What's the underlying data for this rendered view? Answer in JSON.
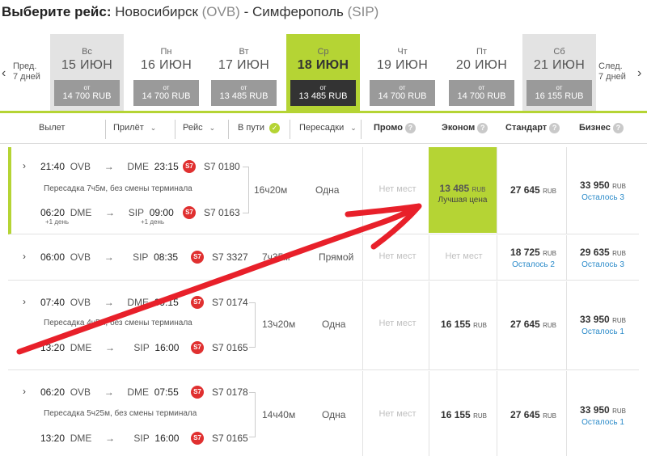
{
  "title": {
    "prefix": "Выберите рейс:",
    "from": "Новосибирск",
    "from_code": "(OVB)",
    "dash": "-",
    "to": "Симферополь",
    "to_code": "(SIP)"
  },
  "nav": {
    "prev": "Пред.",
    "prev_days": "7 дней",
    "next": "След.",
    "next_days": "7 дней"
  },
  "days": [
    {
      "dow": "Вс",
      "date": "15 ИЮН",
      "from": "от",
      "price": "14 700 RUB"
    },
    {
      "dow": "Пн",
      "date": "16 ИЮН",
      "from": "от",
      "price": "14 700 RUB"
    },
    {
      "dow": "Вт",
      "date": "17 ИЮН",
      "from": "от",
      "price": "13 485 RUB"
    },
    {
      "dow": "Ср",
      "date": "18 ИЮН",
      "from": "от",
      "price": "13 485 RUB"
    },
    {
      "dow": "Чт",
      "date": "19 ИЮН",
      "from": "от",
      "price": "14 700 RUB"
    },
    {
      "dow": "Пт",
      "date": "20 ИЮН",
      "from": "от",
      "price": "14 700 RUB"
    },
    {
      "dow": "Сб",
      "date": "21 ИЮН",
      "from": "от",
      "price": "16 155 RUB"
    }
  ],
  "header": {
    "departure": "Вылет",
    "arrival": "Прилёт",
    "flight": "Рейс",
    "duration": "В пути",
    "transfers": "Пересадки",
    "promo": "Промо",
    "economy": "Эконом",
    "standard": "Стандарт",
    "business": "Бизнес",
    "q": "?",
    "dropdown": "⌄",
    "check": "✓"
  },
  "currency": "RUB",
  "flights": [
    {
      "seg1": {
        "dep_time": "21:40",
        "dep_ap": "OVB",
        "arr_ap": "DME",
        "arr_time": "23:15",
        "flight_no": "S7 0180"
      },
      "transfer_note": "Пересадка 7ч5м, без смены терминала",
      "seg2": {
        "dep_time": "06:20",
        "dep_ap": "DME",
        "arr_ap": "SIP",
        "arr_time": "09:00",
        "flight_no": "S7 0163",
        "dep_plus": "+1 день",
        "arr_plus": "+1 день"
      },
      "duration": "16ч20м",
      "stops": "Одна",
      "promo": "Нет мест",
      "economy": "13 485",
      "economy_label": "Лучшая цена",
      "standard": "27 645",
      "business": "33 950",
      "business_sub": "Осталось 3"
    },
    {
      "seg1": {
        "dep_time": "06:00",
        "dep_ap": "OVB",
        "arr_ap": "SIP",
        "arr_time": "08:35",
        "flight_no": "S7 3327"
      },
      "duration": "7ч35м",
      "stops": "Прямой",
      "promo": "Нет мест",
      "economy": "Нет мест",
      "standard": "18 725",
      "standard_sub": "Осталось 2",
      "business": "29 635",
      "business_sub": "Осталось 3"
    },
    {
      "seg1": {
        "dep_time": "07:40",
        "dep_ap": "OVB",
        "arr_ap": "DME",
        "arr_time": "09:15",
        "flight_no": "S7 0174"
      },
      "transfer_note": "Пересадка 4ч5м, без смены терминала",
      "seg2": {
        "dep_time": "13:20",
        "dep_ap": "DME",
        "arr_ap": "SIP",
        "arr_time": "16:00",
        "flight_no": "S7 0165"
      },
      "duration": "13ч20м",
      "stops": "Одна",
      "promo": "Нет мест",
      "economy": "16 155",
      "standard": "27 645",
      "business": "33 950",
      "business_sub": "Осталось 1"
    },
    {
      "seg1": {
        "dep_time": "06:20",
        "dep_ap": "OVB",
        "arr_ap": "DME",
        "arr_time": "07:55",
        "flight_no": "S7 0178"
      },
      "transfer_note": "Пересадка 5ч25м, без смены терминала",
      "seg2": {
        "dep_time": "13:20",
        "dep_ap": "DME",
        "arr_ap": "SIP",
        "arr_time": "16:00",
        "flight_no": "S7 0165"
      },
      "duration": "14ч40м",
      "stops": "Одна",
      "promo": "Нет мест",
      "economy": "16 155",
      "standard": "27 645",
      "business": "33 950",
      "business_sub": "Осталось 1"
    }
  ],
  "arrow_glyph": "→",
  "expand_glyph": "›",
  "logo_text": "S7",
  "colors": {
    "accent": "#b5d434",
    "annotation": "#e8202a",
    "link": "#2a8ac9"
  }
}
